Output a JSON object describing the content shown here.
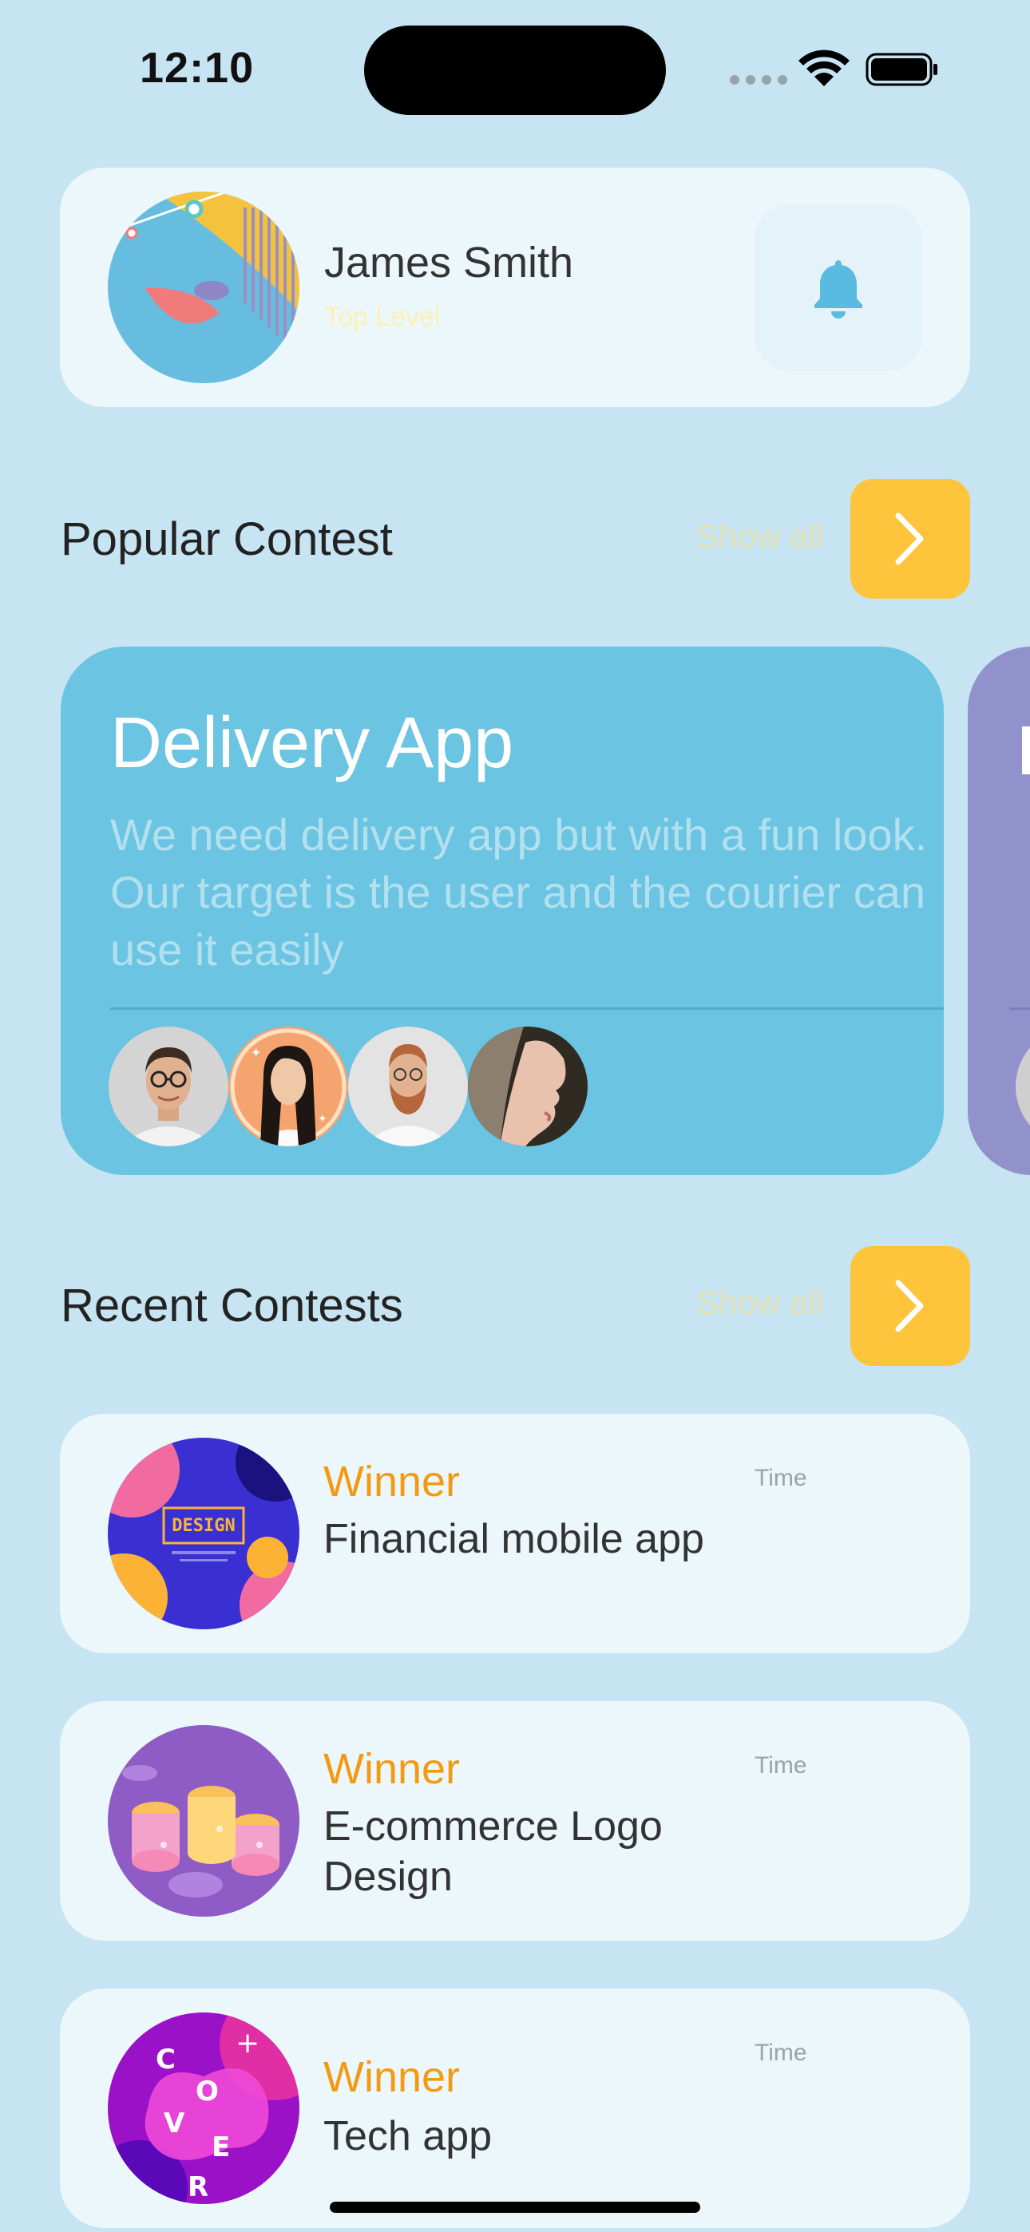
{
  "status_bar": {
    "time": "12:10"
  },
  "profile": {
    "name": "James Smith",
    "level": "Top Level"
  },
  "popular": {
    "title": "Popular Contest",
    "show_all": "Show all",
    "cards": [
      {
        "title": "Delivery App",
        "description": "We need delivery app but with a fun look. Our target is the user and the courier can use it easily"
      }
    ]
  },
  "recent": {
    "title": "Recent Contests",
    "show_all": "Show all",
    "items": [
      {
        "status": "Winner",
        "name": "Financial mobile app",
        "time": "Time"
      },
      {
        "status": "Winner",
        "name": "E-commerce Logo Design",
        "time": "Time"
      },
      {
        "status": "Winner",
        "name": "Tech app",
        "time": "Time"
      }
    ]
  },
  "colors": {
    "background": "#c6e4f1",
    "card": "#ecf7fc",
    "accent_yellow": "#fdc43c",
    "contest_card": "#6bc4e1",
    "contest_card_next": "#9191cb",
    "winner": "#f39a12"
  },
  "icons": {
    "bell": "bell-icon",
    "arrow": "chevron-right-icon",
    "wifi": "wifi-icon",
    "battery": "battery-icon"
  }
}
